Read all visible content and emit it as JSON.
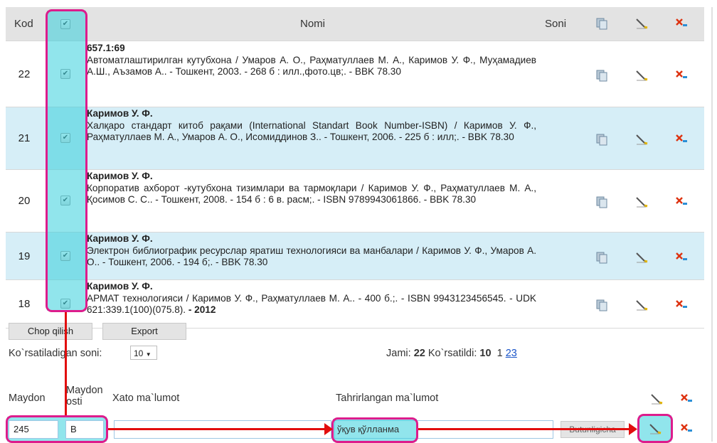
{
  "table": {
    "headers": {
      "kod": "Kod",
      "nomi": "Nomi",
      "soni": "Soni"
    },
    "check_mark": "✔",
    "rows": [
      {
        "kod": "22",
        "head": "657.1:69",
        "body": "Автоматлаштирилган кутубхона / Умаров А. О., Раҳматуллаев М. А., Каримов У. Ф., Муҳамадиев А.Ш., Аъзамов А.. - Тошкент, 2003. - 268 б : илл.,фото.цв;. - BBK 78.30",
        "tail": ""
      },
      {
        "kod": "21",
        "head": "Каримов У. Ф.",
        "body": "Халқаро стандарт китоб рақами (International Standart Book Number-ISBN) / Каримов У. Ф., Раҳматуллаев М. А., Умаров А. О., Исомиддинов З.. - Тошкент, 2006. - 225 б : илл;. - BBK 78.30",
        "tail": ""
      },
      {
        "kod": "20",
        "head": "Каримов У. Ф.",
        "body": "Корпоратив ахборот -кутубхона тизимлари ва тармоқлари / Каримов У. Ф., Раҳматуллаев М. А., Қосимов С. С.. - Тошкент, 2008. - 154 б : 6 в. расм;. - ISBN 9789943061866. - BBK 78.30",
        "tail": ""
      },
      {
        "kod": "19",
        "head": "Каримов У. Ф.",
        "body": "Электрон библиографик ресурслар яратиш технологияси ва манбалари / Каримов У. Ф., Умаров А. О.. - Тошкент, 2006. - 194 б;. - BBK 78.30",
        "tail": ""
      },
      {
        "kod": "18",
        "head": "Каримов У. Ф.",
        "body": "АРМАТ технологияси / Каримов У. Ф., Раҳматуллаев М. А.. - 400 б.;. - ISBN 9943123456545. - UDK 621:339.1(100)(075.8).",
        "tail": " - 2012"
      }
    ]
  },
  "buttons": {
    "print": "Chop qilish",
    "export": "Export"
  },
  "pager": {
    "per_page_label": "Ko`rsatiladigan soni:",
    "per_page_value": "10",
    "total_label": "Jami:",
    "total_value": "22",
    "shown_label": "Ko`rsatildi:",
    "shown_value": "10",
    "page_current": "1",
    "page_2": "2",
    "page_3": "3"
  },
  "edit_form": {
    "col_field": "Maydon",
    "col_subfield": "Maydon osti",
    "col_wrong": "Xato ma`lumot",
    "col_edited": "Tahrirlangan ma`lumot",
    "field_value": "245",
    "subfield_value": "B",
    "edited_value": "ўқув қўлланма",
    "scope_option": "Butunligicha"
  },
  "colors": {
    "highlight_teal": "#37d0dc",
    "frame_pink": "#dd1c8c",
    "arrow_red": "#e20e0e"
  }
}
